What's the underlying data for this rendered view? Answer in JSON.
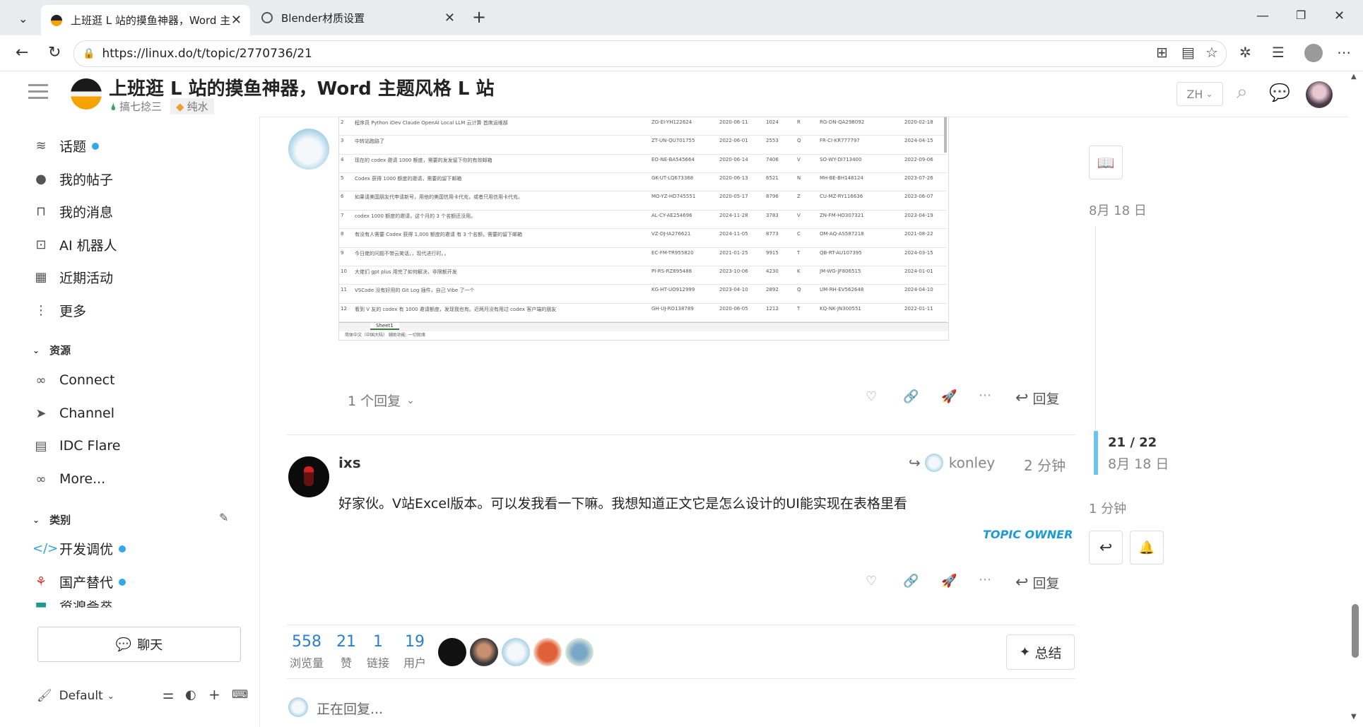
{
  "browser": {
    "tabs": [
      {
        "title": "上班逛 L 站的摸鱼神器，Word 主题",
        "active": true
      },
      {
        "title": "Blender材质设置",
        "active": false
      }
    ],
    "url": "https://linux.do/t/topic/2770736/21"
  },
  "header": {
    "title": "上班逛 L 站的摸鱼神器，Word 主题风格 L 站",
    "category": "搞七捻三",
    "tag": "纯水",
    "lang": "ZH"
  },
  "sidebar": {
    "items": [
      {
        "label": "话题",
        "icon": "layers-icon"
      },
      {
        "label": "我的帖子",
        "icon": "user-icon"
      },
      {
        "label": "我的消息",
        "icon": "inbox-icon"
      },
      {
        "label": "AI 机器人",
        "icon": "robot-icon"
      },
      {
        "label": "近期活动",
        "icon": "calendar-icon"
      },
      {
        "label": "更多",
        "icon": "more-icon"
      }
    ],
    "resources_title": "资源",
    "resources": [
      {
        "label": "Connect"
      },
      {
        "label": "Channel"
      },
      {
        "label": "IDC Flare"
      },
      {
        "label": "More..."
      }
    ],
    "categories_title": "类别",
    "categories": [
      {
        "label": "开发调优"
      },
      {
        "label": "国产替代"
      },
      {
        "label": "资源荟萃"
      }
    ],
    "chat_label": "聊天",
    "theme_label": "Default"
  },
  "post1": {
    "replies_label": "1 个回复",
    "reply_label": "回复"
  },
  "post2": {
    "author": "ixs",
    "reply_to": "konley",
    "time": "2 分钟",
    "body": "好家伙。V站Excel版本。可以发我看一下嘛。我想知道正文它是怎么设计的UI能实现在表格里看",
    "badge": "TOPIC OWNER",
    "reply_label": "回复"
  },
  "stats": {
    "views": "558",
    "views_label": "浏览量",
    "likes": "21",
    "likes_label": "赞",
    "links": "1",
    "links_label": "链接",
    "users": "19",
    "users_label": "用户",
    "summary_label": "总结"
  },
  "replying": "正在回复...",
  "timeline": {
    "top_date": "8月 18 日",
    "position": "21 / 22",
    "current_date": "8月 18 日",
    "bottom": "1 分钟"
  },
  "sheet": {
    "rows": [
      {
        "num": "2",
        "text": "程序员  Python  iDev  Claude  OpenAI  Local LLM  云计算  首席运维部",
        "id": "ZG-EI-YH122624",
        "d": "2020-06-11",
        "n": "1024",
        "c": "R",
        "id2": "RG-DN-QA298092",
        "d2": "2020-02-18"
      },
      {
        "num": "3",
        "text": "中转站跑路了",
        "id": "ZT-UN-QU701755",
        "d": "2022-06-01",
        "n": "2553",
        "c": "Q",
        "id2": "FR-CI-KR777797",
        "d2": "2024-04-15"
      },
      {
        "num": "4",
        "text": "现在的 codex 邀请 1000 额度，需要的发发留下你的有效邮箱",
        "id": "EO-NE-BA545664",
        "d": "2020-06-14",
        "n": "7406",
        "c": "V",
        "id2": "SO-WY-DI713400",
        "d2": "2022-09-06"
      },
      {
        "num": "5",
        "text": "Codex 获得 1000 额度的邀请，需要的留下邮箱",
        "id": "GK-UT-LQ673368",
        "d": "2020-06-13",
        "n": "6521",
        "c": "N",
        "id2": "MH-BE-BH148124",
        "d2": "2023-07-26"
      },
      {
        "num": "6",
        "text": "如果请美国朋友代申请新号，用他的美国信用卡代充，或者只用信用卡代充。",
        "id": "MO-YZ-HD745551",
        "d": "2020-05-17",
        "n": "8796",
        "c": "Z",
        "id2": "CU-MZ-RY116636",
        "d2": "2023-06-07"
      },
      {
        "num": "7",
        "text": "codex 1000 额度的邀请，这个月的 3 个名额还没用。",
        "id": "AL-CY-AE254696",
        "d": "2024-11-28",
        "n": "3783",
        "c": "V",
        "id2": "ZN-FM-HO307321",
        "d2": "2023-04-19"
      },
      {
        "num": "8",
        "text": "有没有人需要 Codex 获得 1,000 额度的邀请 有 3 个名额，需要的留下邮箱",
        "id": "VZ-DJ-IA276621",
        "d": "2024-11-05",
        "n": "8773",
        "c": "C",
        "id2": "OM-AQ-AS587218",
        "d2": "2021-08-22"
      },
      {
        "num": "9",
        "text": "今日佬的问题不带云笑话，，现代进行时。，",
        "id": "EC-FM-TR955820",
        "d": "2021-01-25",
        "n": "9915",
        "c": "T",
        "id2": "QB-RT-AU107395",
        "d2": "2024-03-15"
      },
      {
        "num": "10",
        "text": "大佬们 gpt plus 用完了如何解决，非限额开发",
        "id": "PI-RS-RZ895488",
        "d": "2023-10-06",
        "n": "4230",
        "c": "K",
        "id2": "JM-WG-JF806515",
        "d2": "2024-01-01"
      },
      {
        "num": "11",
        "text": "VSCode 没有好用的 Git Log 插件，自己 Vibe 了一个",
        "id": "KG-HT-UO912999",
        "d": "2023-04-10",
        "n": "2892",
        "c": "Q",
        "id2": "UM-RH-EV562648",
        "d2": "2024-04-10"
      },
      {
        "num": "12",
        "text": "看到 V 友的 codex 有 1000 邀请额度，发现我也有。近两月没有用过 codex 客户端的朋友",
        "id": "GH-UJ-RO138789",
        "d": "2020-06-05",
        "n": "1212",
        "c": "T",
        "id2": "KQ-NK-JN300551",
        "d2": "2022-01-11"
      }
    ],
    "sheet_tab": "Sheet1",
    "status": "简体中文（中国大陆）  辅助功能: 一切就绪"
  },
  "colors": {
    "accent": "#2a7fd4",
    "dot": "#34a8e8",
    "owner": "#1a9bd8"
  }
}
